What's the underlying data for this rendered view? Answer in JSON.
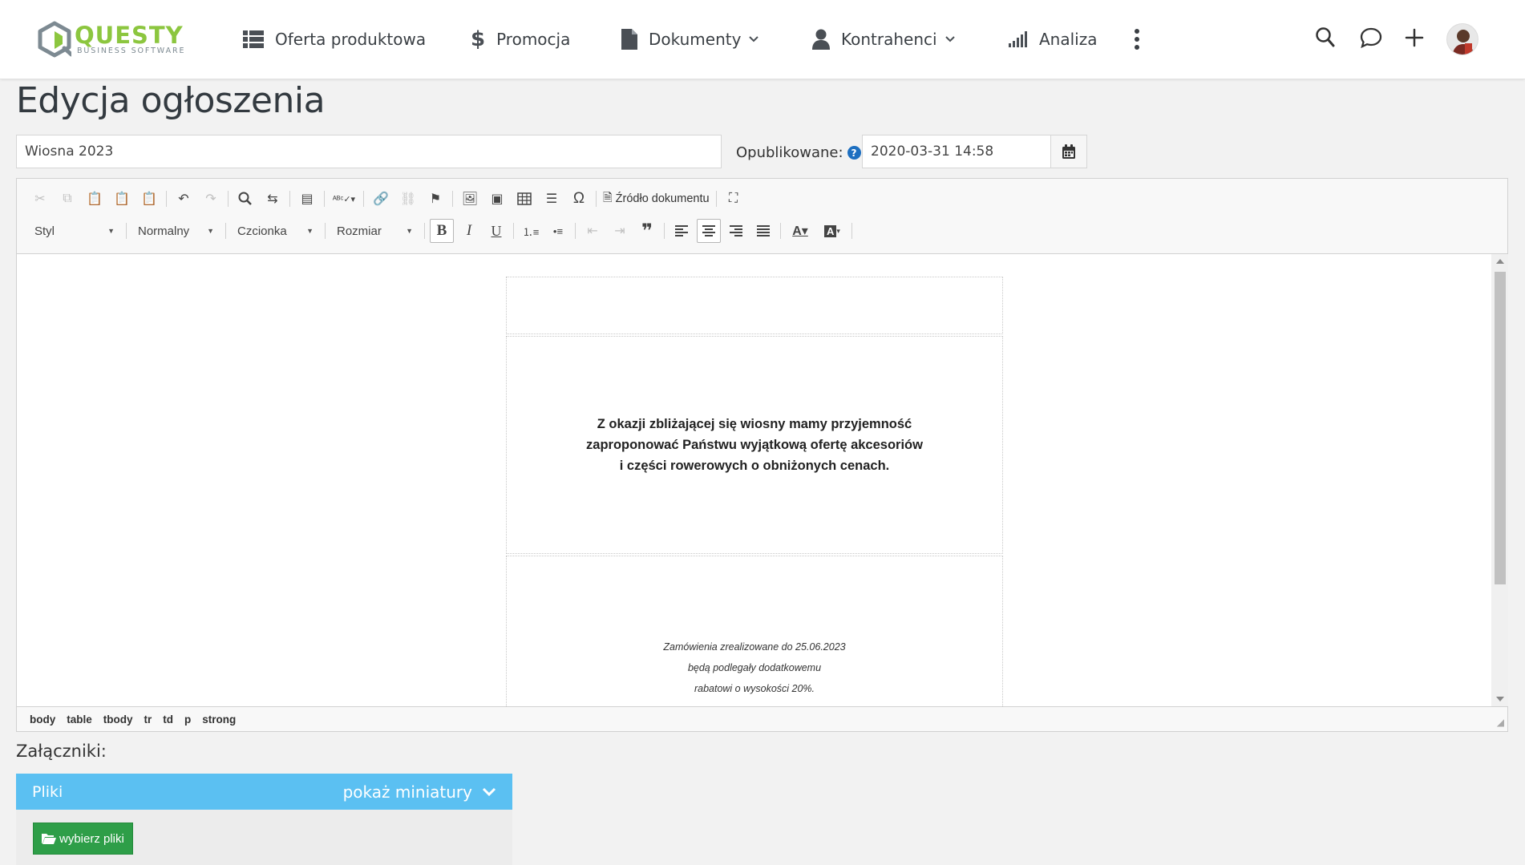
{
  "header": {
    "logo_name": "QUESTY",
    "logo_sub": "BUSINESS SOFTWARE",
    "nav": [
      {
        "label": "Oferta produktowa",
        "icon": "list-icon"
      },
      {
        "label": "Promocja",
        "icon": "dollar-icon"
      },
      {
        "label": "Dokumenty",
        "icon": "document-icon",
        "dropdown": true
      },
      {
        "label": "Kontrahenci",
        "icon": "user-icon",
        "dropdown": true
      },
      {
        "label": "Analiza",
        "icon": "signal-bars-icon"
      }
    ],
    "right_icons": [
      "search-icon",
      "chat-icon",
      "plus-icon",
      "avatar"
    ]
  },
  "page": {
    "title": "Edycja ogłoszenia",
    "name_value": "Wiosna 2023",
    "published_label": "Opublikowane:",
    "published_value": "2020-03-31 14:58"
  },
  "editor": {
    "source_label": "Źródło dokumentu",
    "style_combo": "Styl",
    "format_combo": "Normalny",
    "font_combo": "Czcionka",
    "size_combo": "Rozmiar",
    "content": {
      "main_lines": [
        "Z okazji zbliżającej się wiosny mamy przyjemność",
        "zaproponować Państwu wyjątkową ofertę akcesoriów",
        "i części rowerowych o obniżonych cenach."
      ],
      "note_lines": [
        "Zamówienia zrealizowane do 25.06.2023",
        "będą podlegały dodatkowemu",
        "rabatowi o wysokości 20%."
      ]
    },
    "path": [
      "body",
      "table",
      "tbody",
      "tr",
      "td",
      "p",
      "strong"
    ]
  },
  "attachments": {
    "label": "Załączniki:",
    "panel_title": "Pliki",
    "thumbnails_toggle": "pokaż miniatury",
    "pick_button": "wybierz pliki"
  },
  "colors": {
    "brand_green": "#8cc63f",
    "panel_blue": "#5bc0f2",
    "button_green": "#2e9e48",
    "help_blue": "#1e6fc0"
  }
}
